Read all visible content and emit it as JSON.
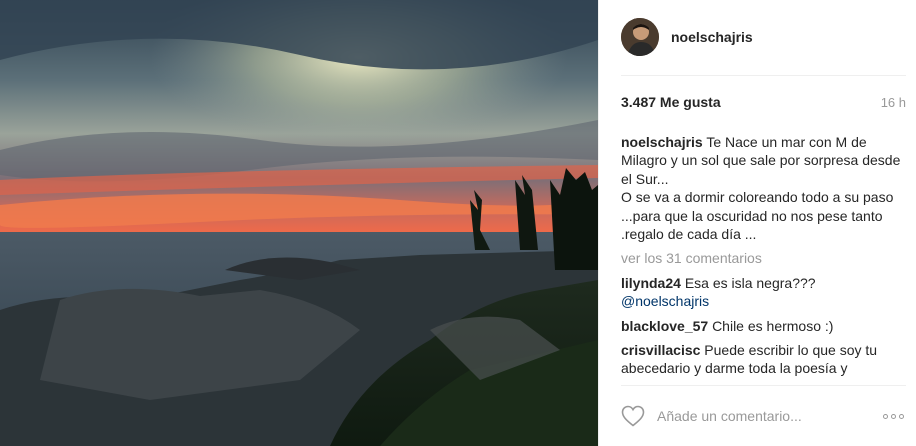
{
  "post": {
    "photo_icon": "sunset-photo",
    "username": "noelschajris",
    "likes": "3.487 Me gusta",
    "time": "16 h",
    "caption": {
      "username": "noelschajris",
      "text": "Te Nace un mar con M de Milagro y un sol que sale por sorpresa desde el Sur...",
      "text2": "O se va a dormir coloreando todo a su paso ...para que la oscuridad no nos pese tanto .regalo de cada día ..."
    },
    "load_more": "ver los 31 comentarios",
    "comments": [
      {
        "username": "lilynda24",
        "text": "Esa es isla negra???",
        "mention": "@noelschajris"
      },
      {
        "username": "blacklove_57",
        "text": "Chile es hermoso :)"
      },
      {
        "username": "crisvillacisc",
        "text": "Puede escribir lo que soy tu abecedario y darme toda la poesía y"
      }
    ],
    "add_comment_placeholder": "Añade un comentario...",
    "icons": {
      "like": "heart-icon",
      "more": "more-options-icon"
    }
  }
}
